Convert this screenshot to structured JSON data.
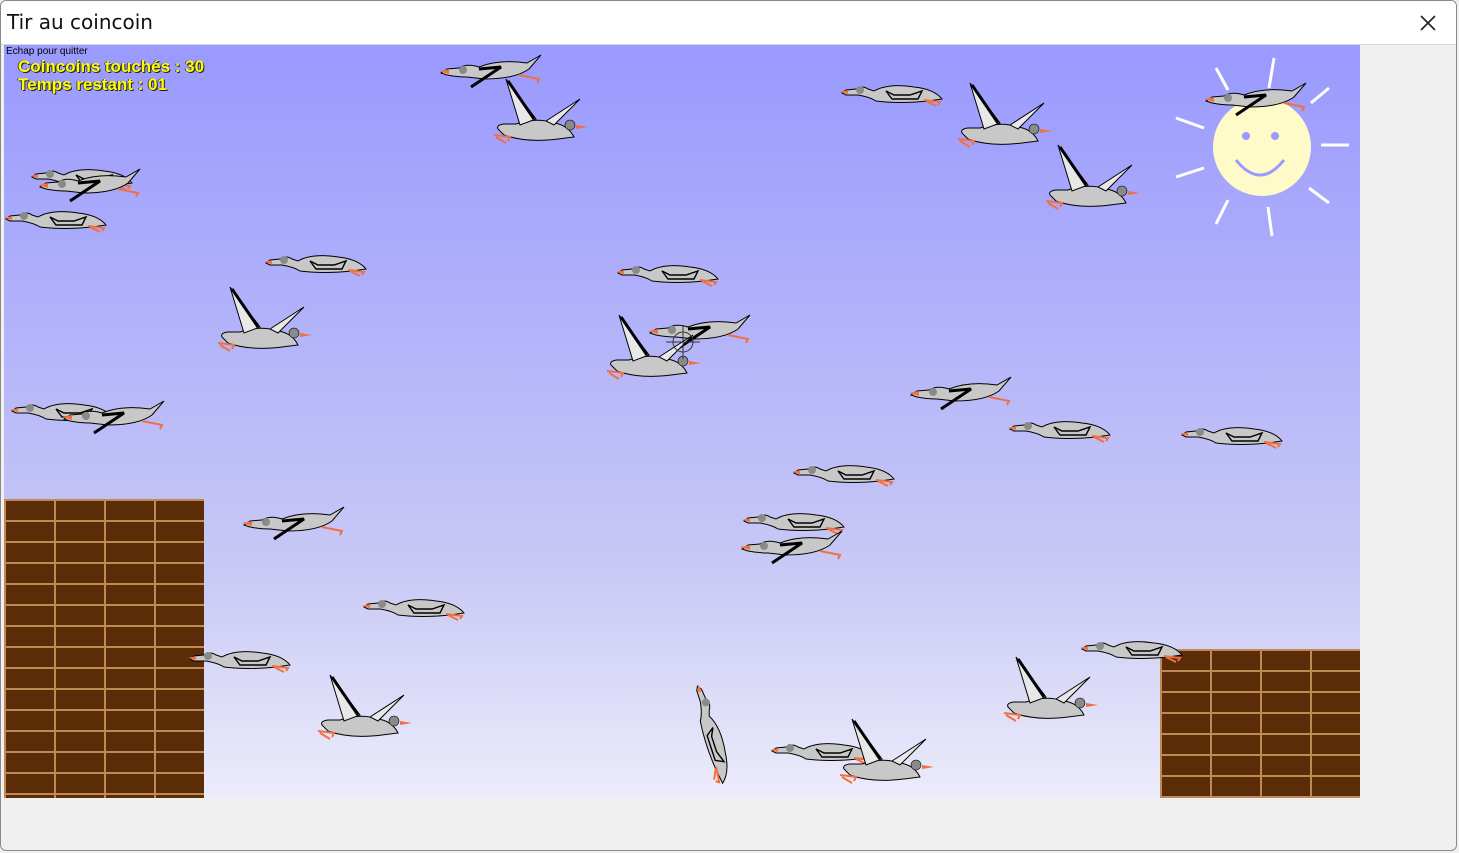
{
  "window": {
    "title": "Tir au coincoin"
  },
  "hud": {
    "hint": "Echap pour quitter",
    "score": "Coincoins touchés : 30",
    "time": "Temps restant : 01"
  },
  "icons": {
    "close": "close-icon",
    "sun": "sun-icon",
    "crosshair": "crosshair-icon"
  },
  "colors": {
    "sky_top": "#9999ff",
    "sky_bottom": "#ececfb",
    "hud_text": "#ffff00",
    "brick": "#5a2d08",
    "mortar": "#c08a55",
    "sun": "#fffbc8"
  }
}
